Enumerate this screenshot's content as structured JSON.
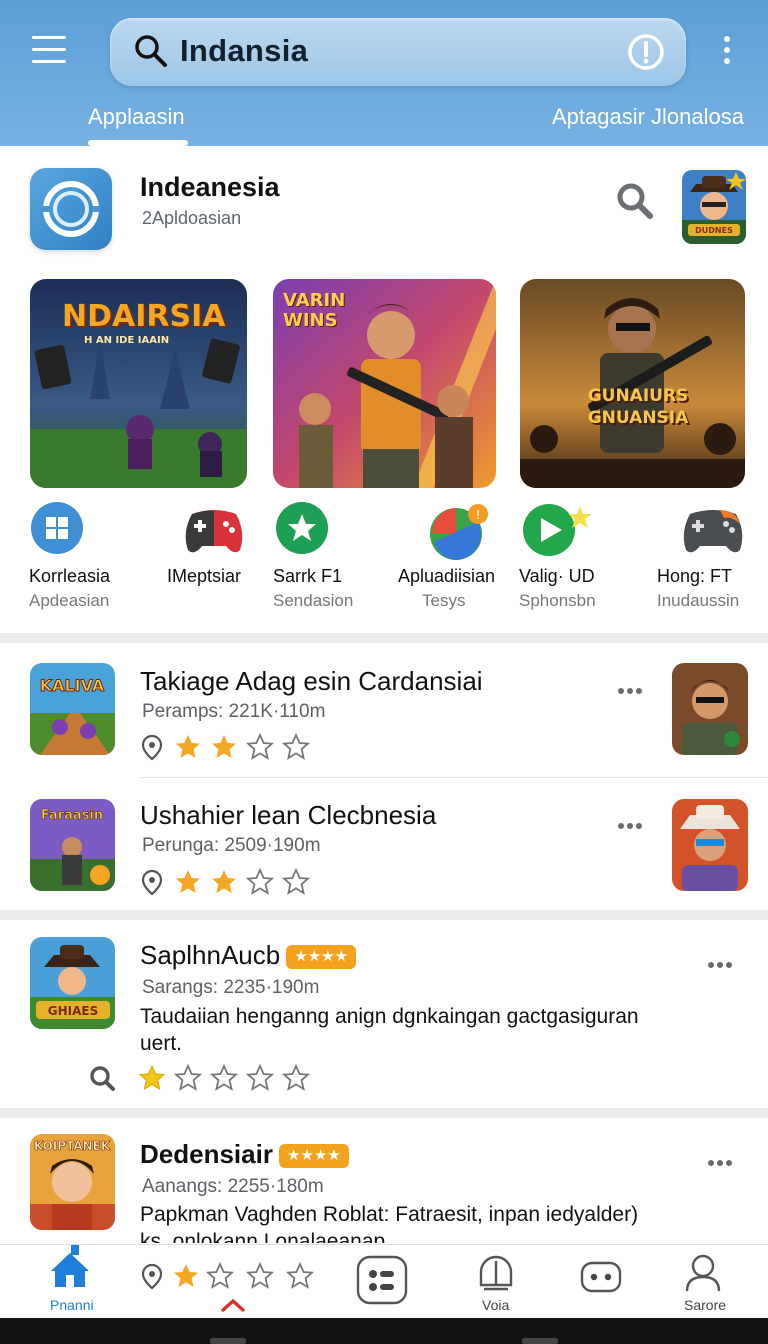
{
  "header": {
    "search_query": "Indansia",
    "tabs": [
      {
        "label": "Applaasin",
        "active": true
      },
      {
        "label": "Aptagasir Jlonalosa",
        "active": false
      }
    ],
    "colors": {
      "bar": "#5d9fd6",
      "accent": "#2f7fc4"
    }
  },
  "app": {
    "title": "Indeanesia",
    "subtitle": "2Apldoasian"
  },
  "banners": [
    {
      "title": "NDAIRSIA",
      "subtitle": "H AN IDE IAAIN"
    },
    {
      "title": "VARIN WINS",
      "subtitle": ""
    },
    {
      "title": "GUNAIURS GNUANSIA",
      "subtitle": ""
    }
  ],
  "categories": [
    {
      "name": "Korrleasia",
      "sub": "Apdeasian",
      "icon": "windows-icon"
    },
    {
      "name": "IMeptsiar",
      "sub": "",
      "icon": "gamepad-red-icon"
    },
    {
      "name": "Sarrk F1",
      "sub": "Sendasion",
      "icon": "star-badge-icon"
    },
    {
      "name": "Apluadiisian",
      "sub": "Tesys",
      "icon": "ball-icon"
    },
    {
      "name": "Valig· UD",
      "sub": "Sphonsbn",
      "icon": "play-icon"
    },
    {
      "name": "Hong: FT",
      "sub": "Inudaussin",
      "icon": "gamepad-dark-icon"
    }
  ],
  "list": [
    {
      "title": "Takiage Adag esin Cardansiai",
      "meta": "Peramps: 221K·110m",
      "rating": 2,
      "thumb_text": "KALIVA",
      "badge": "",
      "desc": ""
    },
    {
      "title": "Ushahier lean Clecbnesia",
      "meta": "Perunga: 2509·190m",
      "rating": 2,
      "thumb_text": "Faraasin",
      "badge": "",
      "desc": ""
    },
    {
      "title": "SaplhnAucb",
      "meta": "Sarangs: 2235·190m",
      "rating": 1,
      "thumb_text": "GHIAES",
      "badge": "★★★★",
      "desc": "Taudaiian henganng anign dgnkaingan gactgasiguran uert."
    },
    {
      "title": "Dedensiair",
      "meta": "Aanangs: 2255·180m",
      "rating": 0,
      "thumb_text": "KOIPTANEK",
      "badge": "★★★★",
      "desc": "Papkman Vaghden Roblat: Fatraesit, inpan iedyalder) ks. onlokann Lonalaeanap"
    }
  ],
  "bottom_nav": {
    "home_label": "Pnanni",
    "voice_label": "Voia",
    "profile_label": "Sarore"
  }
}
